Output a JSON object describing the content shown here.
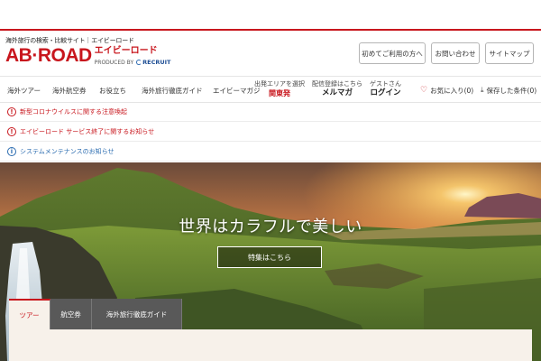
{
  "brand": {
    "tagline": "海外旅行の検索・比較サイト｜エイビーロード",
    "logo_en": "AB·ROAD",
    "logo_ja": "エイビーロード",
    "produced_by": "PRODUCED BY",
    "company": "RECRUIT",
    "color": "#c8161d"
  },
  "utility_links": [
    "初めてご利用の方へ",
    "お問い合わせ",
    "サイトマップ"
  ],
  "nav": {
    "items": [
      "海外ツアー",
      "海外航空券",
      "お役立ち",
      "海外旅行徹底ガイド",
      "エイビーマガジ"
    ],
    "departure": {
      "label": "出発エリアを選択",
      "value": "関東発"
    },
    "newsletter": {
      "label": "配信登録はこちら",
      "value": "メルマガ"
    },
    "guest": {
      "label": "ゲストさん",
      "value": "ログイン"
    },
    "favorites": "お気に入り(0)",
    "saved": "保存した条件(0)"
  },
  "notices": [
    {
      "type": "alert",
      "icon": "!",
      "text": "新型コロナウイルスに関する注意喚起"
    },
    {
      "type": "alert",
      "icon": "!",
      "text": "エイビーロード サービス終了に関するお知らせ"
    },
    {
      "type": "info",
      "icon": "i",
      "text": "システムメンテナンスのお知らせ"
    }
  ],
  "hero": {
    "title": "世界はカラフルで美しい",
    "button": "特集はこちら"
  },
  "search_tabs": [
    "ツアー",
    "航空券",
    "海外旅行徹底ガイド"
  ],
  "active_search_tab": "ツアー"
}
